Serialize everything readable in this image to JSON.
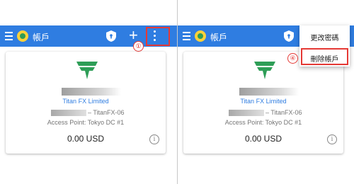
{
  "appbar": {
    "title": "帳戶"
  },
  "account": {
    "company": "Titan FX Limited",
    "server": "– TitanFX-06",
    "access_point": "Access Point: Tokyo DC #1",
    "balance": "0.00 USD"
  },
  "steps": {
    "step1": "①",
    "step4": "④"
  },
  "menu": {
    "items": [
      "更改密碼",
      "刪除帳戶"
    ]
  },
  "colors": {
    "appbar": "#2f7de1",
    "highlight": "#e53935",
    "brand_green": "#2e9e57"
  },
  "icons": [
    "menu-icon",
    "app-logo-icon",
    "shield-icon",
    "plus-icon",
    "more-vert-icon",
    "titan-logo",
    "info-icon"
  ]
}
